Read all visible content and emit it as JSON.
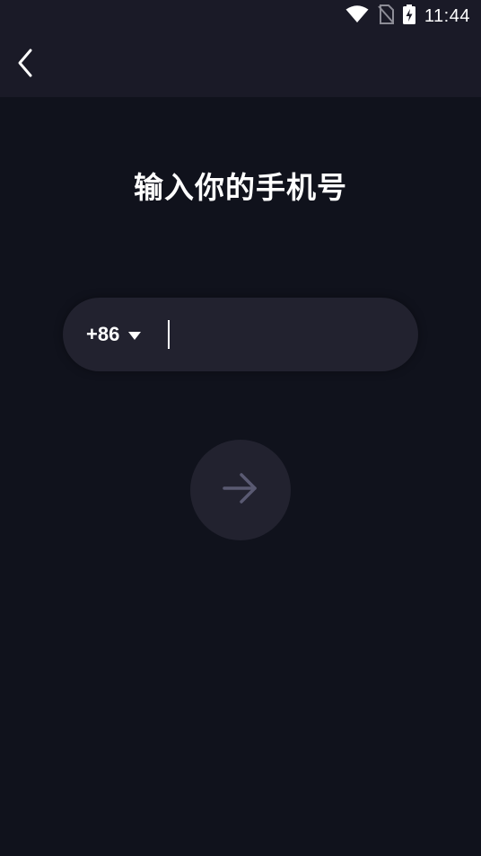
{
  "status_bar": {
    "time": "11:44",
    "icons": [
      "wifi-icon",
      "no-sim-icon",
      "battery-charging-icon"
    ]
  },
  "header": {
    "back_icon": "chevron-left-icon"
  },
  "title": "输入你的手机号",
  "phone_input": {
    "country_code": "+86",
    "dropdown_icon": "caret-down-icon",
    "value": "",
    "placeholder": ""
  },
  "next_button": {
    "icon": "arrow-right-icon",
    "enabled": false
  },
  "colors": {
    "background": "#10121c",
    "header": "#1a1a27",
    "field": "#22222f",
    "arrow_disabled": "#5a5a72",
    "text": "#ffffff"
  }
}
